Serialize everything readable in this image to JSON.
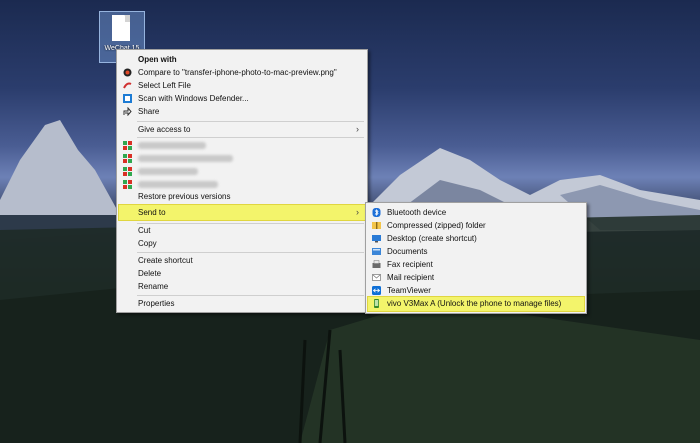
{
  "desktop": {
    "icon_label": "WeChat 15",
    "colors": {
      "menu_bg": "#f2f2f2",
      "highlight": "#f3f46b"
    }
  },
  "context_menu": {
    "open_with": "Open with",
    "compare_to": "Compare to \"transfer-iphone-photo-to-mac-preview.png\"",
    "select_left_file": "Select Left File",
    "scan_defender": "Scan with Windows Defender...",
    "share": "Share",
    "give_access_to": "Give access to",
    "restore_previous_versions": "Restore previous versions",
    "send_to": "Send to",
    "cut": "Cut",
    "copy": "Copy",
    "create_shortcut": "Create shortcut",
    "delete": "Delete",
    "rename": "Rename",
    "properties": "Properties"
  },
  "send_to_menu": {
    "items": [
      {
        "label": "Bluetooth device",
        "icon": "bluetooth-icon"
      },
      {
        "label": "Compressed (zipped) folder",
        "icon": "zip-folder-icon"
      },
      {
        "label": "Desktop (create shortcut)",
        "icon": "desktop-icon"
      },
      {
        "label": "Documents",
        "icon": "documents-icon"
      },
      {
        "label": "Fax recipient",
        "icon": "fax-icon"
      },
      {
        "label": "Mail recipient",
        "icon": "mail-icon"
      },
      {
        "label": "TeamViewer",
        "icon": "teamviewer-icon"
      },
      {
        "label": "vivo V3Max A (Unlock the phone to manage files)",
        "icon": "phone-icon"
      }
    ]
  }
}
